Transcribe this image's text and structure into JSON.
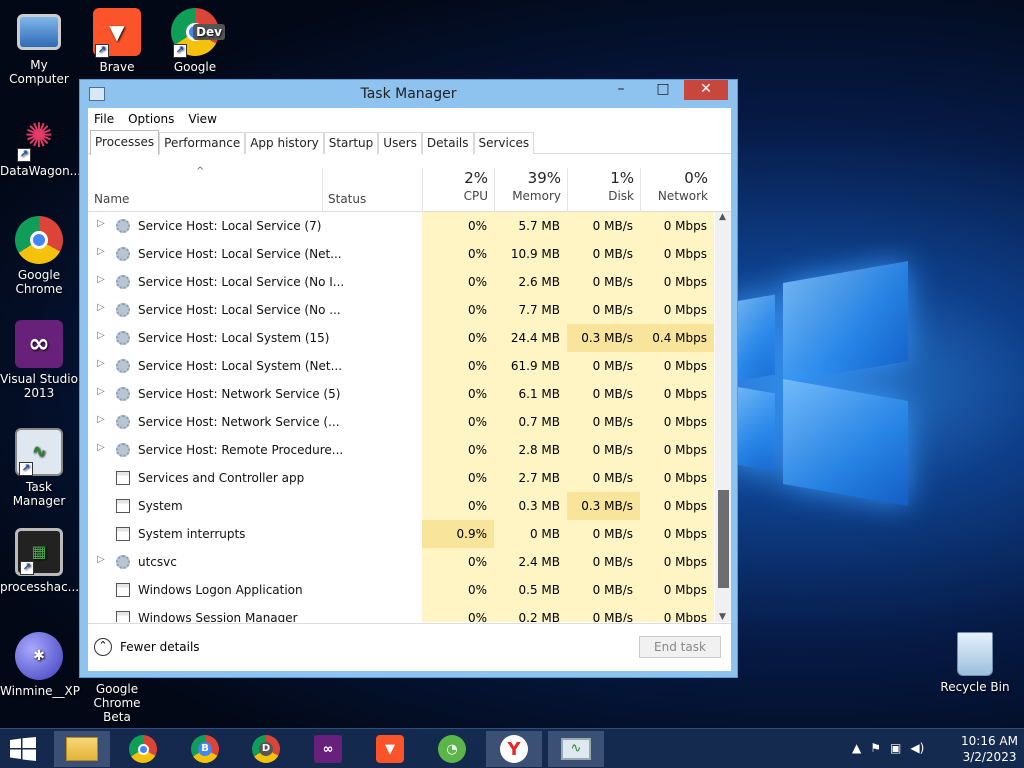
{
  "desktop": {
    "icons": [
      {
        "label": "My Computer"
      },
      {
        "label": "Brave"
      },
      {
        "label": "Google Chrome Dev",
        "badge": "Dev"
      },
      {
        "label": "DataWagon..."
      },
      {
        "label": "Google Chrome"
      },
      {
        "label": "Visual Studio 2013"
      },
      {
        "label": "Task Manager"
      },
      {
        "label": "processhac..."
      },
      {
        "label": "Winmine__XP"
      },
      {
        "label": "Google Chrome Beta"
      },
      {
        "label": "Recycle Bin"
      }
    ]
  },
  "window": {
    "title": "Task Manager",
    "minimize": "–",
    "maximize": "□",
    "close": "✕"
  },
  "menu": [
    "File",
    "Options",
    "View"
  ],
  "tabs": [
    "Processes",
    "Performance",
    "App history",
    "Startup",
    "Users",
    "Details",
    "Services"
  ],
  "header": {
    "sort_arrow": "^",
    "name": "Name",
    "status": "Status",
    "cpu": {
      "pct": "2%",
      "label": "CPU"
    },
    "memory": {
      "pct": "39%",
      "label": "Memory"
    },
    "disk": {
      "pct": "1%",
      "label": "Disk"
    },
    "network": {
      "pct": "0%",
      "label": "Network"
    }
  },
  "rows": [
    {
      "name": "Service Host: Local Service (7)",
      "expand": true,
      "icon": "gear",
      "cpu": "0%",
      "mem": "5.7 MB",
      "disk": "0 MB/s",
      "net": "0 Mbps"
    },
    {
      "name": "Service Host: Local Service (Net...",
      "expand": true,
      "icon": "gear",
      "cpu": "0%",
      "mem": "10.9 MB",
      "disk": "0 MB/s",
      "net": "0 Mbps"
    },
    {
      "name": "Service Host: Local Service (No I...",
      "expand": true,
      "icon": "gear",
      "cpu": "0%",
      "mem": "2.6 MB",
      "disk": "0 MB/s",
      "net": "0 Mbps"
    },
    {
      "name": "Service Host: Local Service (No ...",
      "expand": true,
      "icon": "gear",
      "cpu": "0%",
      "mem": "7.7 MB",
      "disk": "0 MB/s",
      "net": "0 Mbps"
    },
    {
      "name": "Service Host: Local System (15)",
      "expand": true,
      "icon": "gear",
      "cpu": "0%",
      "mem": "24.4 MB",
      "disk": "0.3 MB/s",
      "net": "0.4 Mbps",
      "hi_disk": true,
      "hi_net": true
    },
    {
      "name": "Service Host: Local System (Net...",
      "expand": true,
      "icon": "gear",
      "cpu": "0%",
      "mem": "61.9 MB",
      "disk": "0 MB/s",
      "net": "0 Mbps"
    },
    {
      "name": "Service Host: Network Service (5)",
      "expand": true,
      "icon": "gear",
      "cpu": "0%",
      "mem": "6.1 MB",
      "disk": "0 MB/s",
      "net": "0 Mbps"
    },
    {
      "name": "Service Host: Network Service (...",
      "expand": true,
      "icon": "gear",
      "cpu": "0%",
      "mem": "0.7 MB",
      "disk": "0 MB/s",
      "net": "0 Mbps"
    },
    {
      "name": "Service Host: Remote Procedure...",
      "expand": true,
      "icon": "gear",
      "cpu": "0%",
      "mem": "2.8 MB",
      "disk": "0 MB/s",
      "net": "0 Mbps"
    },
    {
      "name": "Services and Controller app",
      "expand": false,
      "icon": "window",
      "cpu": "0%",
      "mem": "2.7 MB",
      "disk": "0 MB/s",
      "net": "0 Mbps"
    },
    {
      "name": "System",
      "expand": false,
      "icon": "window",
      "cpu": "0%",
      "mem": "0.3 MB",
      "disk": "0.3 MB/s",
      "net": "0 Mbps",
      "hi_disk": true
    },
    {
      "name": "System interrupts",
      "expand": false,
      "icon": "window",
      "cpu": "0.9%",
      "mem": "0 MB",
      "disk": "0 MB/s",
      "net": "0 Mbps",
      "hi_cpu": true
    },
    {
      "name": "utcsvc",
      "expand": true,
      "icon": "gear",
      "cpu": "0%",
      "mem": "2.4 MB",
      "disk": "0 MB/s",
      "net": "0 Mbps"
    },
    {
      "name": "Windows Logon Application",
      "expand": false,
      "icon": "window",
      "cpu": "0%",
      "mem": "0.5 MB",
      "disk": "0 MB/s",
      "net": "0 Mbps"
    },
    {
      "name": "Windows Session Manager",
      "expand": false,
      "icon": "window",
      "cpu": "0%",
      "mem": "0.2 MB",
      "disk": "0 MB/s",
      "net": "0 Mbps"
    }
  ],
  "footer": {
    "fewer_details": "Fewer details",
    "end_task": "End task"
  },
  "taskbar": {
    "apps": [
      "file-explorer",
      "chrome",
      "chrome-beta",
      "chrome-dev",
      "visual-studio",
      "brave",
      "cent-browser",
      "yandex",
      "task-manager"
    ],
    "labels": {
      "chrome_beta": "B",
      "chrome_dev": "D",
      "yandex": "Y"
    },
    "time": "10:16 AM",
    "date": "3/2/2023"
  },
  "colors": {
    "accent": "#8ec2ef",
    "heat_light": "#fff4c4",
    "heat_strong": "#f9e49b",
    "close": "#c7473c"
  }
}
